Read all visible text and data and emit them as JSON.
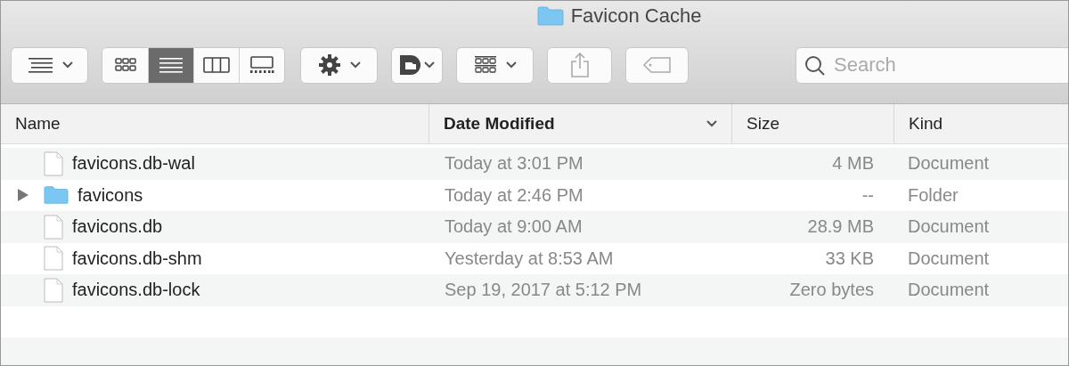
{
  "window": {
    "title": "Favicon Cache"
  },
  "toolbar": {
    "view_modes": [
      {
        "kind": "icons",
        "selected": false
      },
      {
        "kind": "list",
        "selected": true
      },
      {
        "kind": "columns",
        "selected": false
      },
      {
        "kind": "gallery",
        "selected": false
      }
    ],
    "search": {
      "placeholder": "Search"
    }
  },
  "table": {
    "columns": [
      {
        "label": "Name",
        "sorted": false
      },
      {
        "label": "Date Modified",
        "sorted": true
      },
      {
        "label": "Size",
        "sorted": false
      },
      {
        "label": "Kind",
        "sorted": false
      }
    ],
    "rows": [
      {
        "kind": "file",
        "name": "favicons.db-wal",
        "date": "Today at 3:01 PM",
        "size": "4 MB",
        "type": "Document"
      },
      {
        "kind": "folder",
        "expanded": false,
        "name": "favicons",
        "date": "Today at 2:46 PM",
        "size": "--",
        "type": "Folder"
      },
      {
        "kind": "file",
        "name": "favicons.db",
        "date": "Today at 9:00 AM",
        "size": "28.9 MB",
        "type": "Document"
      },
      {
        "kind": "file",
        "name": "favicons.db-shm",
        "date": "Yesterday at 8:53 AM",
        "size": "33 KB",
        "type": "Document"
      },
      {
        "kind": "file",
        "name": "favicons.db-lock",
        "date": "Sep 19, 2017 at 5:12 PM",
        "size": "Zero bytes",
        "type": "Document"
      }
    ]
  }
}
